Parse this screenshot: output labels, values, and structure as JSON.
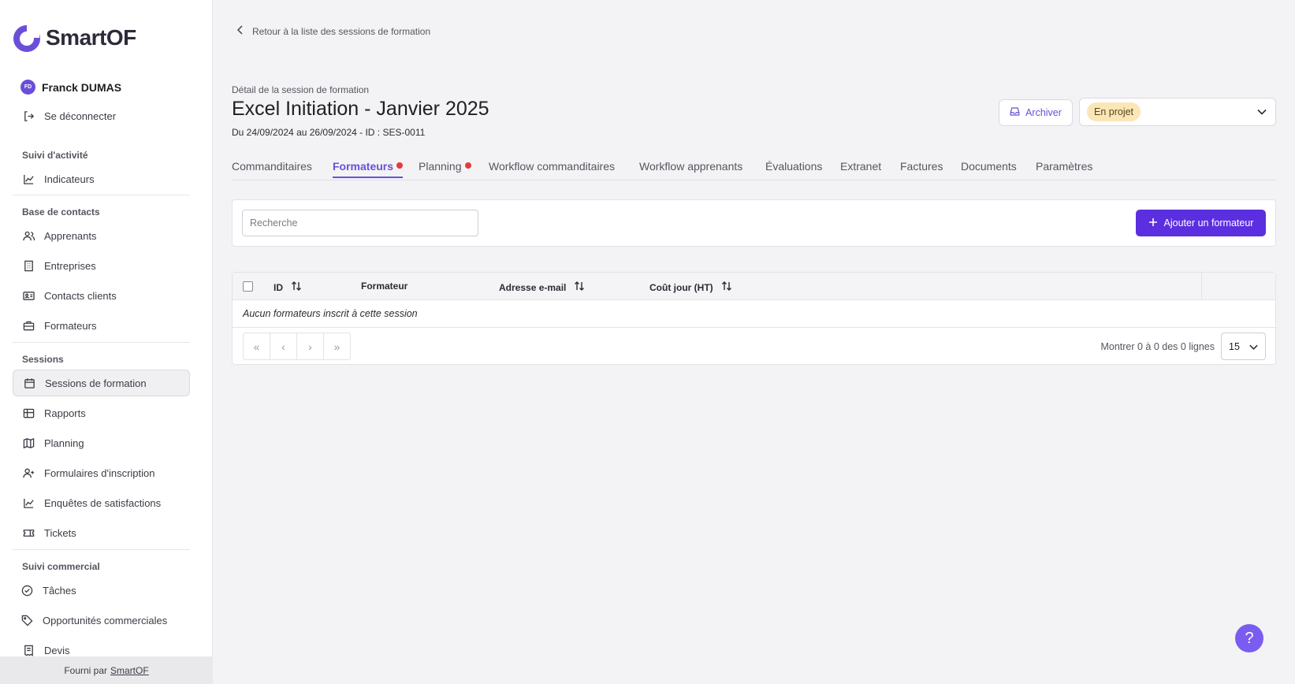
{
  "app": {
    "name": "SmartOF",
    "brand_color": "#6b4fd8"
  },
  "user": {
    "initials": "FD",
    "name": "Franck DUMAS",
    "logout_label": "Se déconnecter"
  },
  "sidebar": {
    "sections": {
      "activity": "Suivi d'activité",
      "contacts": "Base de contacts",
      "sessions": "Sessions",
      "commercial": "Suivi commercial"
    },
    "items": {
      "indicateurs": "Indicateurs",
      "apprenants": "Apprenants",
      "entreprises": "Entreprises",
      "contacts_clients": "Contacts clients",
      "formateurs": "Formateurs",
      "sessions_formation": "Sessions de formation",
      "rapports": "Rapports",
      "planning": "Planning",
      "formulaires": "Formulaires d'inscription",
      "enquetes": "Enquêtes de satisfactions",
      "tickets": "Tickets",
      "taches": "Tâches",
      "opportunites": "Opportunités commerciales",
      "devis": "Devis"
    },
    "footer": {
      "prefix": "Fourni par",
      "link": "SmartOF"
    }
  },
  "page": {
    "back_label": "Retour à la liste des sessions de formation",
    "subtitle": "Détail de la session de formation",
    "title": "Excel Initiation - Janvier 2025",
    "meta": "Du 24/09/2024 au 26/09/2024 - ID : SES-0011",
    "archive_label": "Archiver",
    "status": "En projet"
  },
  "tabs": [
    {
      "label": "Commanditaires",
      "active": false,
      "alert": false
    },
    {
      "label": "Formateurs",
      "active": true,
      "alert": true
    },
    {
      "label": "Planning",
      "active": false,
      "alert": true
    },
    {
      "label": "Workflow commanditaires",
      "active": false,
      "alert": false
    },
    {
      "label": "Workflow apprenants",
      "active": false,
      "alert": false
    },
    {
      "label": "Évaluations",
      "active": false,
      "alert": false
    },
    {
      "label": "Extranet",
      "active": false,
      "alert": false
    },
    {
      "label": "Factures",
      "active": false,
      "alert": false
    },
    {
      "label": "Documents",
      "active": false,
      "alert": false
    },
    {
      "label": "Paramètres",
      "active": false,
      "alert": false
    }
  ],
  "search": {
    "placeholder": "Recherche",
    "value": ""
  },
  "add_button_label": "Ajouter un formateur",
  "table": {
    "columns": [
      "ID",
      "Formateur",
      "Adresse e-mail",
      "Coût jour (HT)"
    ],
    "empty_text": "Aucun formateurs inscrit à cette session",
    "rows_info": "Montrer 0 à 0 des 0 lignes",
    "per_page": "15"
  },
  "help_label": "?"
}
